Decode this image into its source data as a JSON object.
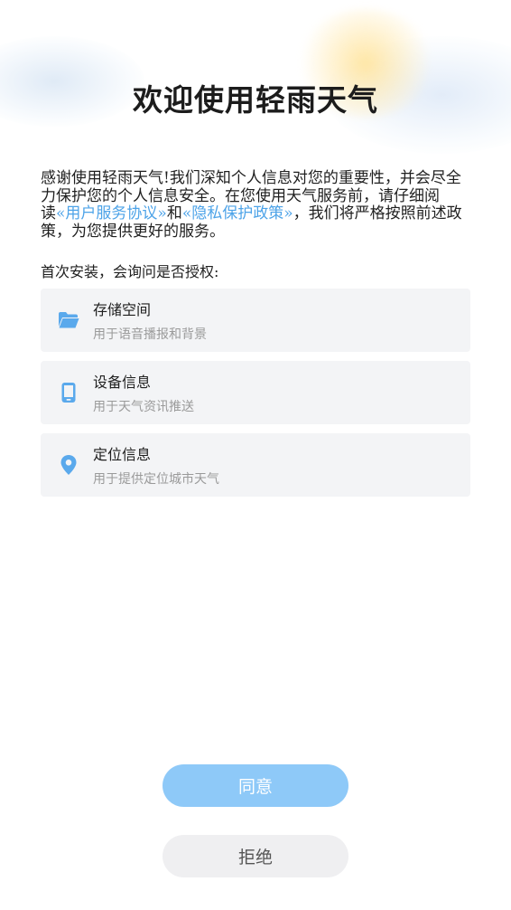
{
  "title": "欢迎使用轻雨天气",
  "intro": {
    "text_before": "感谢使用轻雨天气!我们深知个人信息对您的重要性，并会尽全力保护您的个人信息安全。在您使用天气服务前，请仔细阅读",
    "link_user_agreement": "«用户服务协议»",
    "text_and": "和",
    "link_privacy_policy": "«隐私保护政策»",
    "text_after": "，我们将严格按照前述政策，为您提供更好的服务。"
  },
  "ask_label": "首次安装，会询问是否授权:",
  "permissions": [
    {
      "icon": "folder-icon",
      "title": "存储空间",
      "desc": "用于语音播报和背景"
    },
    {
      "icon": "phone-icon",
      "title": "设备信息",
      "desc": "用于天气资讯推送"
    },
    {
      "icon": "location-pin-icon",
      "title": "定位信息",
      "desc": "用于提供定位城市天气"
    }
  ],
  "buttons": {
    "agree": "同意",
    "reject": "拒绝"
  },
  "colors": {
    "accent": "#4da3e8",
    "agree_bg": "#8ec9f8",
    "card_bg": "#f3f4f6",
    "reject_bg": "#efeff1"
  }
}
